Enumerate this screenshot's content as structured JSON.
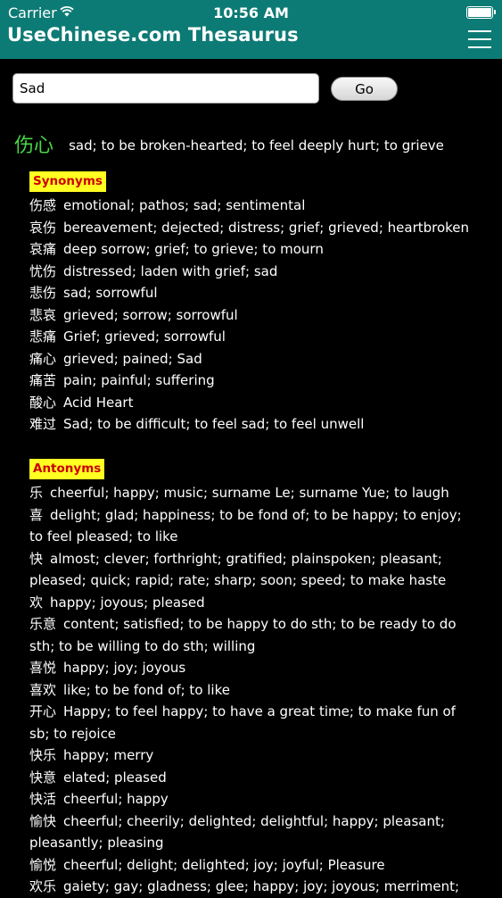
{
  "status_bar": {
    "carrier": "Carrier",
    "time": "10:56 AM"
  },
  "header": {
    "title": "UseChinese.com Thesaurus"
  },
  "search": {
    "value": "Sad",
    "go_label": "Go"
  },
  "headword": {
    "chinese": "伤心",
    "definition": "sad; to be broken-hearted; to feel deeply hurt; to grieve"
  },
  "synonyms": {
    "label": "Synonyms",
    "items": [
      {
        "word": "伤感",
        "definition": "emotional; pathos; sad; sentimental"
      },
      {
        "word": "哀伤",
        "definition": "bereavement; dejected; distress; grief; grieved; heartbroken"
      },
      {
        "word": "哀痛",
        "definition": "deep sorrow; grief; to grieve; to mourn"
      },
      {
        "word": "忧伤",
        "definition": "distressed; laden with grief; sad"
      },
      {
        "word": "悲伤",
        "definition": "sad; sorrowful"
      },
      {
        "word": "悲哀",
        "definition": "grieved; sorrow; sorrowful"
      },
      {
        "word": "悲痛",
        "definition": "Grief; grieved; sorrowful"
      },
      {
        "word": "痛心",
        "definition": "grieved; pained; Sad"
      },
      {
        "word": "痛苦",
        "definition": "pain; painful; suffering"
      },
      {
        "word": "酸心",
        "definition": "Acid Heart"
      },
      {
        "word": "难过",
        "definition": "Sad; to be difficult; to feel sad; to feel unwell"
      }
    ]
  },
  "antonyms": {
    "label": "Antonyms",
    "items": [
      {
        "word": "乐",
        "definition": "cheerful; happy; music; surname Le; surname Yue; to laugh"
      },
      {
        "word": "喜",
        "definition": "delight; glad; happiness; to be fond of; to be happy; to enjoy; to feel pleased; to like"
      },
      {
        "word": "快",
        "definition": "almost; clever; forthright; gratified; plainspoken; pleasant; pleased; quick; rapid; rate; sharp; soon; speed; to make haste"
      },
      {
        "word": "欢",
        "definition": "happy; joyous; pleased"
      },
      {
        "word": "乐意",
        "definition": "content; satisfied; to be happy to do sth; to be ready to do sth; to be willing to do sth; willing"
      },
      {
        "word": "喜悦",
        "definition": "happy; joy; joyous"
      },
      {
        "word": "喜欢",
        "definition": "like; to be fond of; to like"
      },
      {
        "word": "开心",
        "definition": "Happy; to feel happy; to have a great time; to make fun of sb; to rejoice"
      },
      {
        "word": "快乐",
        "definition": "happy; merry"
      },
      {
        "word": "快意",
        "definition": "elated; pleased"
      },
      {
        "word": "快活",
        "definition": "cheerful; happy"
      },
      {
        "word": "愉快",
        "definition": "cheerful; cheerily; delighted; delightful; happy; pleasant; pleasantly; pleasing"
      },
      {
        "word": "愉悦",
        "definition": "cheerful; delight; delighted; joy; joyful; Pleasure"
      },
      {
        "word": "欢乐",
        "definition": "gaiety; gay; gladness; glee; happy; joy; joyous; merriment;"
      }
    ]
  },
  "colors": {
    "header_bg": "#0d7b75",
    "headword": "#47d847",
    "label_bg": "#ffff22",
    "label_text": "#cc0000"
  }
}
